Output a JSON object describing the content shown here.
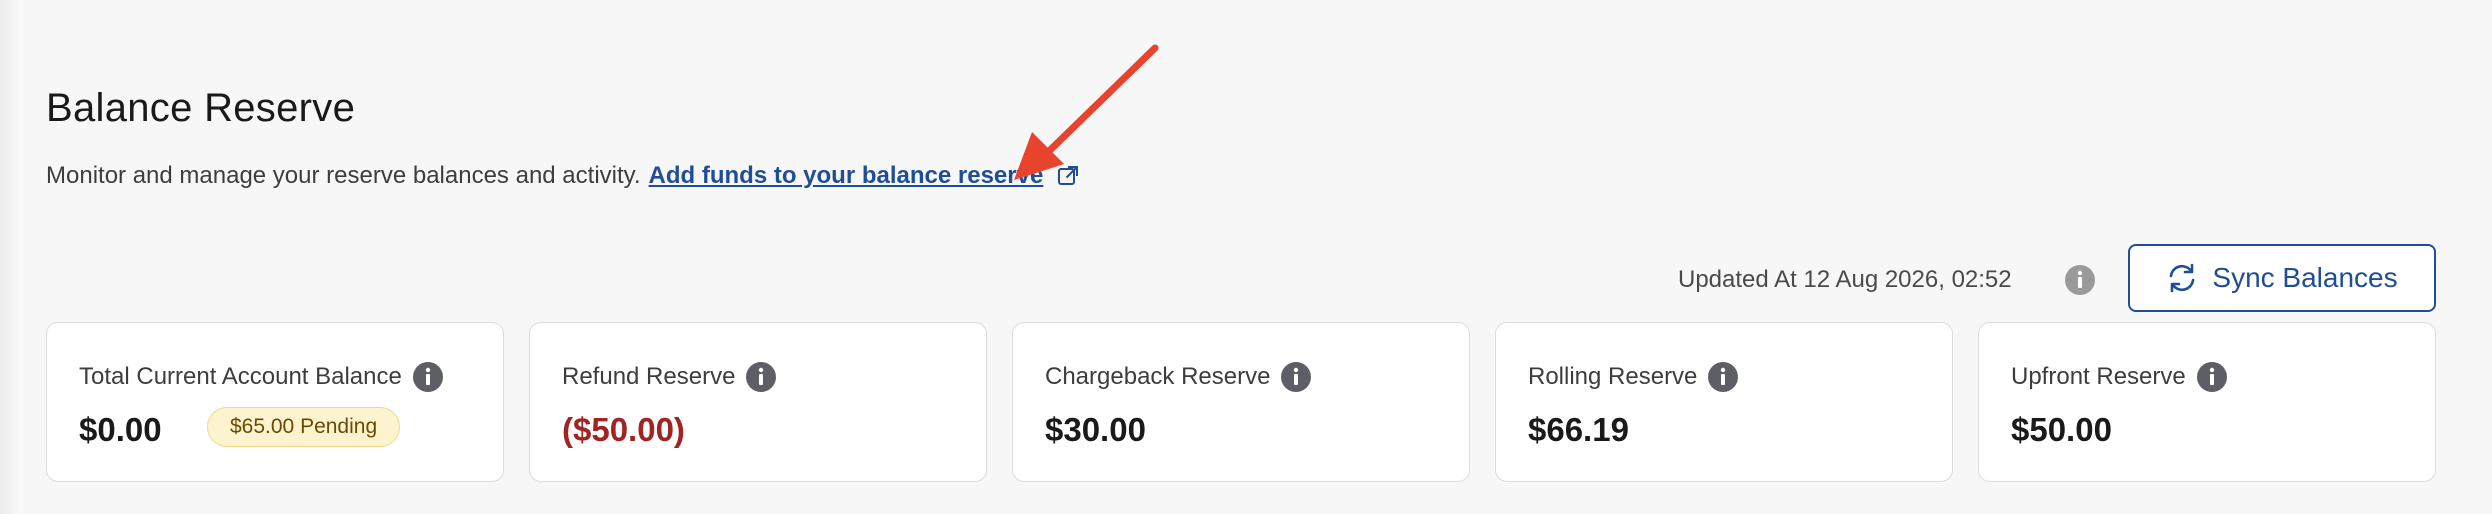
{
  "header": {
    "title": "Balance Reserve",
    "description": "Monitor and manage your reserve balances and activity.",
    "link_label": "Add funds to your balance reserve"
  },
  "toolbar": {
    "updated_text": "Updated At 12 Aug 2026, 02:52",
    "sync_label": "Sync Balances"
  },
  "colors": {
    "accent": "#1f4e96",
    "negative": "#a12424",
    "annotation_arrow": "#e8432c",
    "pending_bg": "#fdf3cf"
  },
  "cards": [
    {
      "label": "Total Current Account Balance",
      "value": "$0.00",
      "badge": "$65.00 Pending"
    },
    {
      "label": "Refund Reserve",
      "value": "($50.00)"
    },
    {
      "label": "Chargeback Reserve",
      "value": "$30.00"
    },
    {
      "label": "Rolling Reserve",
      "value": "$66.19"
    },
    {
      "label": "Upfront Reserve",
      "value": "$50.00"
    }
  ],
  "icons": {
    "info": "info-icon",
    "external": "external-link-icon",
    "sync": "sync-icon",
    "arrow": "annotation-arrow"
  }
}
